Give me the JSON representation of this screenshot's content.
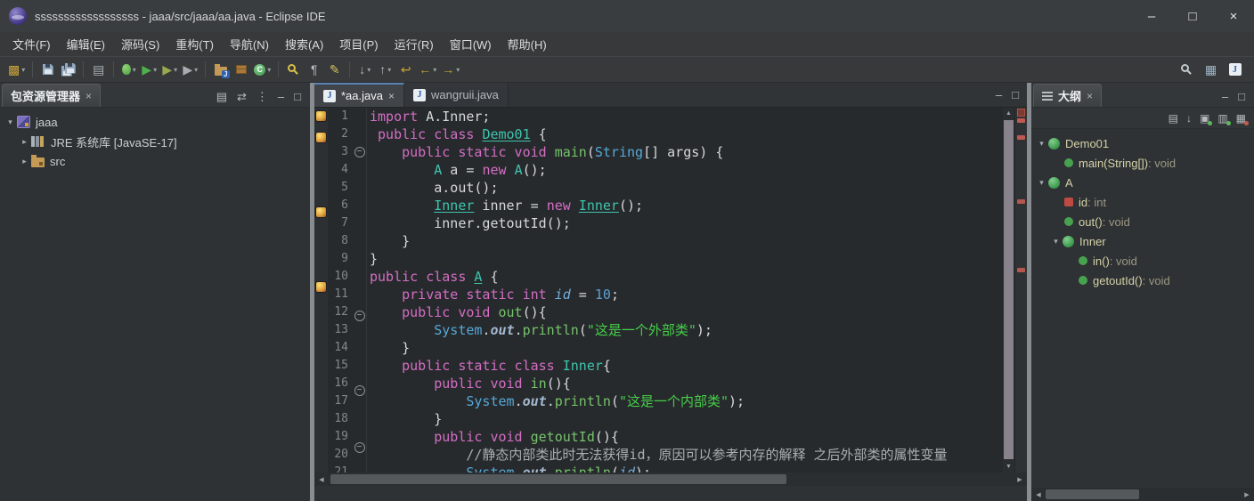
{
  "window": {
    "title": "ssssssssssssssssss - jaaa/src/jaaa/aa.java - Eclipse IDE",
    "controls": [
      {
        "name": "minimize-button",
        "glyph": "–"
      },
      {
        "name": "maximize-button",
        "glyph": "□"
      },
      {
        "name": "close-button",
        "glyph": "×"
      }
    ]
  },
  "icons": {
    "minimize": "–",
    "maximize": "□",
    "close": "×",
    "dropdown": "▾",
    "up": "▲",
    "down": "▼",
    "left": "◀",
    "right": "▶",
    "view_menu": "⋮"
  },
  "menubar": [
    "文件(F)",
    "编辑(E)",
    "源码(S)",
    "重构(T)",
    "导航(N)",
    "搜索(A)",
    "项目(P)",
    "运行(R)",
    "窗口(W)",
    "帮助(H)"
  ],
  "toolbar": {
    "items": [
      {
        "name": "new-wizard-button",
        "glyph": "▩",
        "color": "#c9a23c",
        "dd": true
      },
      {
        "sep": true
      },
      {
        "name": "save-button",
        "special": "floppy"
      },
      {
        "name": "save-all-button",
        "special": "floppy2"
      },
      {
        "sep": true
      },
      {
        "name": "print-button",
        "glyph": "▤",
        "color": "#aab0b4"
      },
      {
        "sep": true
      },
      {
        "name": "debug-button",
        "special": "bug",
        "dd": true
      },
      {
        "name": "run-button",
        "glyph": "▶",
        "color": "#4db24d",
        "dd": true
      },
      {
        "name": "coverage-button",
        "glyph": "▶",
        "color": "#9aa84e",
        "dd": true
      },
      {
        "name": "external-tools-button",
        "glyph": "▶",
        "color": "#a8acb0",
        "dd": true
      },
      {
        "sep": true
      },
      {
        "name": "new-java-project-button",
        "special": "folder",
        "ovl": "J"
      },
      {
        "name": "new-package-button",
        "special": "pkg"
      },
      {
        "name": "new-class-button",
        "special": "classC",
        "dd": true
      },
      {
        "sep": true
      },
      {
        "name": "search-button",
        "special": "mag",
        "y": true
      },
      {
        "name": "show-whitespace-button",
        "glyph": "¶",
        "color": "#b4b9bc"
      },
      {
        "name": "mark-occurrences-button",
        "glyph": "✎",
        "color": "#d2c25c"
      },
      {
        "sep": true
      },
      {
        "name": "next-annotation-button",
        "glyph": "↓",
        "color": "#b4b9bc",
        "dd": true
      },
      {
        "name": "previous-annotation-button",
        "glyph": "↑",
        "color": "#b4b9bc",
        "dd": true
      },
      {
        "name": "last-edit-location-button",
        "glyph": "↩",
        "color": "#c9a23c"
      },
      {
        "name": "back-button",
        "glyph": "←",
        "color": "#c9a23c",
        "dd": true
      },
      {
        "name": "forward-button",
        "glyph": "→",
        "color": "#c9a23c",
        "dd": true
      }
    ],
    "right_items": [
      {
        "name": "quick-access-search-button",
        "special": "mag"
      },
      {
        "name": "open-perspective-button",
        "glyph": "▦",
        "color": "#9fb6c9"
      },
      {
        "name": "java-perspective-button",
        "special": "jbadge"
      }
    ]
  },
  "package_explorer": {
    "title": "包资源管理器",
    "header_icons": [
      {
        "name": "collapse-all-icon",
        "glyph": "▤"
      },
      {
        "name": "link-with-editor-icon",
        "glyph": "⇄"
      },
      {
        "name": "view-menu-icon",
        "glyph": "⋮"
      },
      {
        "name": "minimize-icon",
        "glyph": "–"
      },
      {
        "name": "maximize-icon",
        "glyph": "□"
      }
    ],
    "tree": [
      {
        "depth": 0,
        "exp": "open",
        "icon": "project",
        "label": "jaaa"
      },
      {
        "depth": 1,
        "exp": "closed",
        "icon": "library",
        "label": "JRE 系统库 [JavaSE-17]"
      },
      {
        "depth": 1,
        "exp": "closed",
        "icon": "srcfolder",
        "label": "src"
      }
    ]
  },
  "editor": {
    "tabs": [
      {
        "label": "*aa.java",
        "active": true,
        "closable": true
      },
      {
        "label": "wangruii.java",
        "active": false,
        "closable": false
      }
    ],
    "header_icons": [
      {
        "name": "minimize-icon",
        "glyph": "–"
      },
      {
        "name": "maximize-icon",
        "glyph": "□"
      }
    ],
    "lines": [
      {
        "m": 1,
        "t": [
          [
            "kw",
            "import"
          ],
          [
            "d",
            " A.Inner;"
          ]
        ]
      },
      {
        "m": 1,
        "t": [
          [
            "d",
            " "
          ],
          [
            "kw",
            "public class "
          ],
          [
            "typu",
            "Demo01"
          ],
          [
            "d",
            " {"
          ]
        ]
      },
      {
        "f": 1,
        "t": [
          [
            "d",
            "    "
          ],
          [
            "kw",
            "public static void "
          ],
          [
            "met",
            "main"
          ],
          [
            "d",
            "("
          ],
          [
            "typ2",
            "String"
          ],
          [
            "d",
            "[] args) {"
          ]
        ]
      },
      {
        "t": [
          [
            "d",
            "        "
          ],
          [
            "typ",
            "A"
          ],
          [
            "d",
            " a = "
          ],
          [
            "kw",
            "new"
          ],
          [
            "d",
            " "
          ],
          [
            "typ",
            "A"
          ],
          [
            "d",
            "();"
          ]
        ]
      },
      {
        "t": [
          [
            "d",
            "        a.out();"
          ]
        ]
      },
      {
        "m": 1,
        "t": [
          [
            "d",
            "        "
          ],
          [
            "typu",
            "Inner"
          ],
          [
            "d",
            " inner = "
          ],
          [
            "kw",
            "new"
          ],
          [
            "d",
            " "
          ],
          [
            "typu",
            "Inner"
          ],
          [
            "d",
            "();"
          ]
        ]
      },
      {
        "t": [
          [
            "d",
            "        inner.getoutId();"
          ]
        ]
      },
      {
        "t": [
          [
            "d",
            "    }"
          ]
        ]
      },
      {
        "t": [
          [
            "d",
            "}"
          ]
        ]
      },
      {
        "m": 1,
        "t": [
          [
            "kw",
            "public class "
          ],
          [
            "typu",
            "A"
          ],
          [
            "d",
            " {"
          ]
        ]
      },
      {
        "t": [
          [
            "d",
            "    "
          ],
          [
            "kw",
            "private static int "
          ],
          [
            "fld",
            "id"
          ],
          [
            "d",
            " = "
          ],
          [
            "num",
            "10"
          ],
          [
            "d",
            ";"
          ]
        ]
      },
      {
        "f": 1,
        "t": [
          [
            "d",
            "    "
          ],
          [
            "kw",
            "public void "
          ],
          [
            "met",
            "out"
          ],
          [
            "d",
            "(){"
          ]
        ]
      },
      {
        "t": [
          [
            "d",
            "        "
          ],
          [
            "typ2",
            "System"
          ],
          [
            "d",
            "."
          ],
          [
            "sf",
            "out"
          ],
          [
            "d",
            "."
          ],
          [
            "met",
            "println"
          ],
          [
            "d",
            "("
          ],
          [
            "str",
            "\"这是一个外部类\""
          ],
          [
            "d",
            ");"
          ]
        ]
      },
      {
        "t": [
          [
            "d",
            "    }"
          ]
        ]
      },
      {
        "t": [
          [
            "d",
            "    "
          ],
          [
            "kw",
            "public static class "
          ],
          [
            "typ",
            "Inner"
          ],
          [
            "d",
            "{"
          ]
        ]
      },
      {
        "f": 1,
        "t": [
          [
            "d",
            "        "
          ],
          [
            "kw",
            "public void "
          ],
          [
            "met",
            "in"
          ],
          [
            "d",
            "(){"
          ]
        ]
      },
      {
        "t": [
          [
            "d",
            "            "
          ],
          [
            "typ2",
            "System"
          ],
          [
            "d",
            "."
          ],
          [
            "sf",
            "out"
          ],
          [
            "d",
            "."
          ],
          [
            "met",
            "println"
          ],
          [
            "d",
            "("
          ],
          [
            "str",
            "\"这是一个内部类\""
          ],
          [
            "d",
            ");"
          ]
        ]
      },
      {
        "t": [
          [
            "d",
            "        }"
          ]
        ]
      },
      {
        "f": 1,
        "t": [
          [
            "d",
            "        "
          ],
          [
            "kw",
            "public void "
          ],
          [
            "met",
            "getoutId"
          ],
          [
            "d",
            "(){"
          ]
        ]
      },
      {
        "t": [
          [
            "com",
            "            //静态内部类此时无法获得id，原因可以参考内存的解释 之后外部类的属性变量"
          ]
        ]
      },
      {
        "t": [
          [
            "d",
            "            "
          ],
          [
            "typ2",
            "System"
          ],
          [
            "d",
            "."
          ],
          [
            "sf",
            "out"
          ],
          [
            "d",
            "."
          ],
          [
            "met",
            "println"
          ],
          [
            "d",
            "("
          ],
          [
            "fld",
            "id"
          ],
          [
            "d",
            ");"
          ]
        ]
      }
    ],
    "overview_marks": [
      {
        "pct": 3,
        "color": "#c05a50"
      },
      {
        "pct": 7.5,
        "color": "#c05a50"
      },
      {
        "pct": 25,
        "color": "#b3584c"
      },
      {
        "pct": 44,
        "color": "#b3584c"
      }
    ]
  },
  "outline": {
    "title": "大纲",
    "header_icons": [
      {
        "name": "minimize-icon",
        "glyph": "–"
      },
      {
        "name": "maximize-icon",
        "glyph": "□"
      }
    ],
    "toolbar": [
      {
        "name": "collapse-all-icon",
        "glyph": "▤"
      },
      {
        "name": "sort-icon",
        "glyph": "↓"
      },
      {
        "name": "hide-fields-icon",
        "glyph": "▣",
        "dot": "#5cb85c"
      },
      {
        "name": "hide-static-members-icon",
        "glyph": "▥",
        "dot": "#5cb85c"
      },
      {
        "name": "hide-non-public-members-icon",
        "glyph": "▦",
        "dot": "#c05a50"
      }
    ],
    "tree": [
      {
        "depth": 0,
        "exp": "open",
        "icon": "class",
        "label": "Demo01"
      },
      {
        "depth": 1,
        "icon": "method",
        "label": "main(String[])",
        "suffix": " : void"
      },
      {
        "depth": 0,
        "exp": "open",
        "icon": "class",
        "label": "A"
      },
      {
        "depth": 1,
        "icon": "field",
        "label": "id",
        "suffix": " : int"
      },
      {
        "depth": 1,
        "icon": "method",
        "label": "out()",
        "suffix": " : void"
      },
      {
        "depth": 1,
        "exp": "open",
        "icon": "class",
        "label": "Inner"
      },
      {
        "depth": 2,
        "icon": "method",
        "label": "in()",
        "suffix": " : void"
      },
      {
        "depth": 2,
        "icon": "method",
        "label": "getoutId()",
        "suffix": " : void"
      }
    ]
  },
  "colors": {
    "keyword": "#d36ec4",
    "type": "#3ec4ae",
    "type_blue": "#56a8d8",
    "method": "#76c36c",
    "string": "#46cf4a",
    "number": "#5d9fd4",
    "comment": "#a9aeb2",
    "editor_bg": "#272a2c",
    "panel_bg": "#2f3234",
    "chrome_bg": "#37393b",
    "warning_mark": "#c05a50",
    "tab_accent": "#5a82b4"
  }
}
